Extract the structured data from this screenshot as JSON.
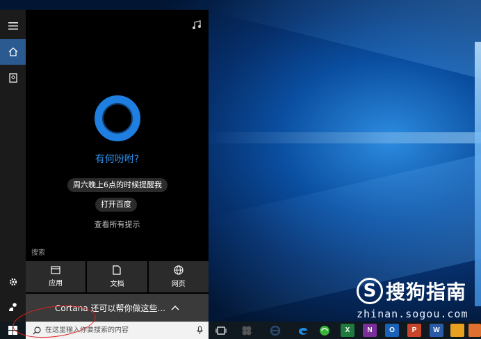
{
  "cortana": {
    "greeting": "有何吩咐?",
    "suggestions": [
      "周六晚上6点的时候提醒我",
      "打开百度"
    ],
    "see_all": "查看所有提示",
    "search_heading": "搜索",
    "tiles": [
      {
        "label": "应用",
        "icon": "app-window-icon"
      },
      {
        "label": "文档",
        "icon": "document-icon"
      },
      {
        "label": "网页",
        "icon": "globe-icon"
      }
    ],
    "expander_label": "Cortana 还可以帮你做这些..."
  },
  "taskbar": {
    "search_placeholder": "在这里输入你要搜索的内容",
    "pinned": [
      {
        "name": "task-view-icon"
      },
      {
        "name": "sogou-pinyin-icon"
      },
      {
        "name": "ie-icon"
      },
      {
        "name": "edge-icon"
      },
      {
        "name": "360-browser-icon"
      },
      {
        "name": "excel-icon",
        "letter": "X"
      },
      {
        "name": "onenote-icon",
        "letter": "N"
      },
      {
        "name": "outlook-icon",
        "letter": "O"
      },
      {
        "name": "powerpoint-icon",
        "letter": "P"
      },
      {
        "name": "word-icon",
        "letter": "W"
      },
      {
        "name": "app-icon"
      },
      {
        "name": "app-icon-2"
      }
    ]
  },
  "watermark": {
    "logo_letter": "S",
    "text": "搜狗指南",
    "url": "zhinan.sogou.com"
  },
  "colors": {
    "accent": "#1e7fe0",
    "greeting": "#2d8fe8",
    "active_rail": "#2a5a8f"
  }
}
